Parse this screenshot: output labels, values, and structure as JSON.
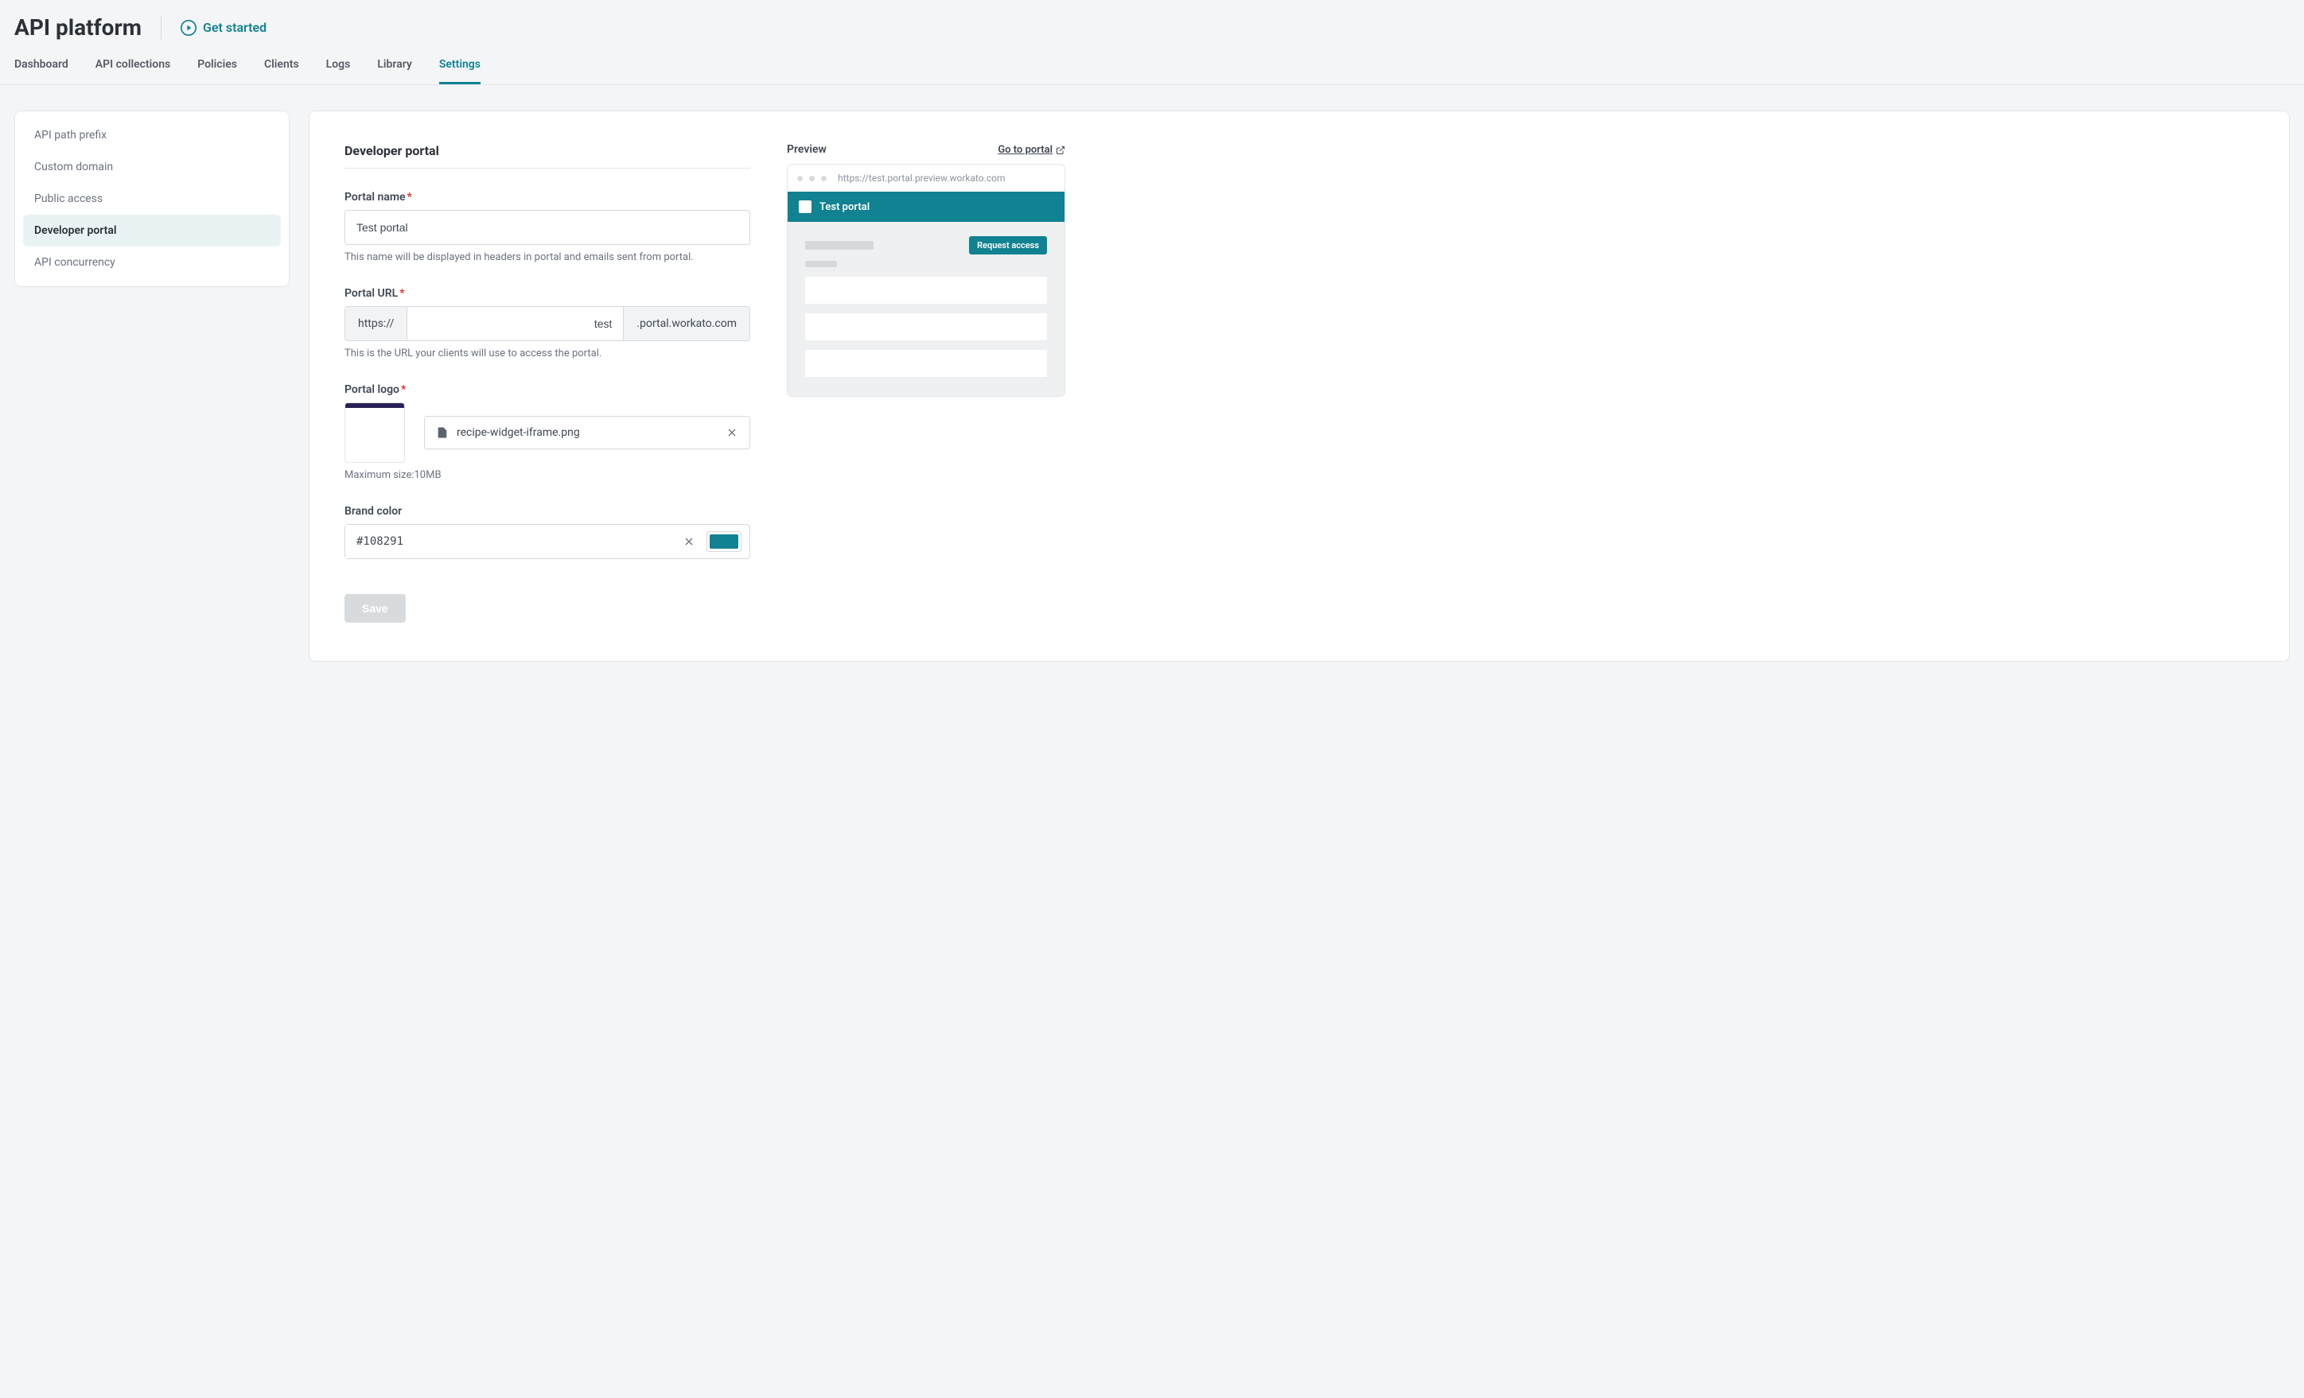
{
  "header": {
    "title": "API platform",
    "get_started": "Get started"
  },
  "tabs": {
    "items": [
      "Dashboard",
      "API collections",
      "Policies",
      "Clients",
      "Logs",
      "Library",
      "Settings"
    ],
    "active": "Settings"
  },
  "sidebar": {
    "items": [
      "API path prefix",
      "Custom domain",
      "Public access",
      "Developer portal",
      "API concurrency"
    ],
    "active": "Developer portal"
  },
  "main": {
    "section_title": "Developer portal",
    "portal_name": {
      "label": "Portal name",
      "value": "Test portal",
      "helper": "This name will be displayed in headers in portal and emails sent from portal."
    },
    "portal_url": {
      "label": "Portal URL",
      "prefix": "https://",
      "value": "test",
      "suffix": ".portal.workato.com",
      "helper": "This is the URL your clients will use to access the portal."
    },
    "portal_logo": {
      "label": "Portal logo",
      "filename": "recipe-widget-iframe.png",
      "max_size": "Maximum size:10MB"
    },
    "brand_color": {
      "label": "Brand color",
      "value": "#108291"
    },
    "save_button": "Save"
  },
  "preview": {
    "label": "Preview",
    "goto": "Go to portal",
    "url": "https://test.portal.preview.workato.com",
    "brand_title": "Test portal",
    "request_access": "Request access"
  }
}
